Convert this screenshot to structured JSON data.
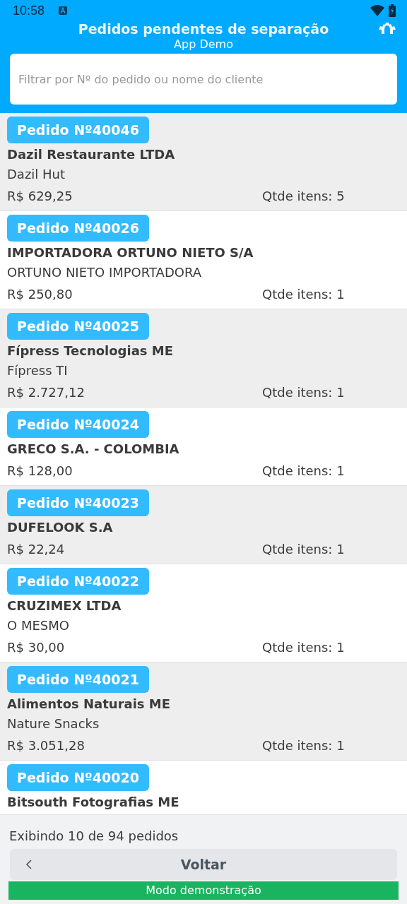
{
  "status_bar": {
    "time": "10:58"
  },
  "header": {
    "title": "Pedidos pendentes de separação",
    "subtitle": "App Demo"
  },
  "search": {
    "placeholder": "Filtrar por Nº do pedido ou nome do cliente"
  },
  "orders": [
    {
      "badge": "Pedido Nº40046",
      "name": "Dazil Restaurante LTDA",
      "alias": "Dazil Hut",
      "total": "R$ 629,25",
      "items": "Qtde itens: 5"
    },
    {
      "badge": "Pedido Nº40026",
      "name": "IMPORTADORA ORTUNO NIETO S/A",
      "alias": "ORTUNO NIETO IMPORTADORA",
      "total": "R$ 250,80",
      "items": "Qtde itens: 1"
    },
    {
      "badge": "Pedido Nº40025",
      "name": "Fípress Tecnologias ME",
      "alias": "Fípress TI",
      "total": "R$ 2.727,12",
      "items": "Qtde itens: 1"
    },
    {
      "badge": "Pedido Nº40024",
      "name": "GRECO S.A. - COLOMBIA",
      "total": "R$ 128,00",
      "items": "Qtde itens: 1"
    },
    {
      "badge": "Pedido Nº40023",
      "name": "DUFELOOK S.A",
      "total": "R$ 22,24",
      "items": "Qtde itens: 1"
    },
    {
      "badge": "Pedido Nº40022",
      "name": "CRUZIMEX LTDA",
      "alias": "O MESMO",
      "total": "R$ 30,00",
      "items": "Qtde itens: 1"
    },
    {
      "badge": "Pedido Nº40021",
      "name": "Alimentos Naturais ME",
      "alias": "Nature Snacks",
      "total": "R$ 3.051,28",
      "items": "Qtde itens: 1"
    },
    {
      "badge": "Pedido Nº40020",
      "name": "Bitsouth Fotografias ME"
    }
  ],
  "footer": {
    "count": "Exibindo 10 de 94 pedidos",
    "back_button": "Voltar",
    "demo_banner": "Modo demonstração"
  }
}
